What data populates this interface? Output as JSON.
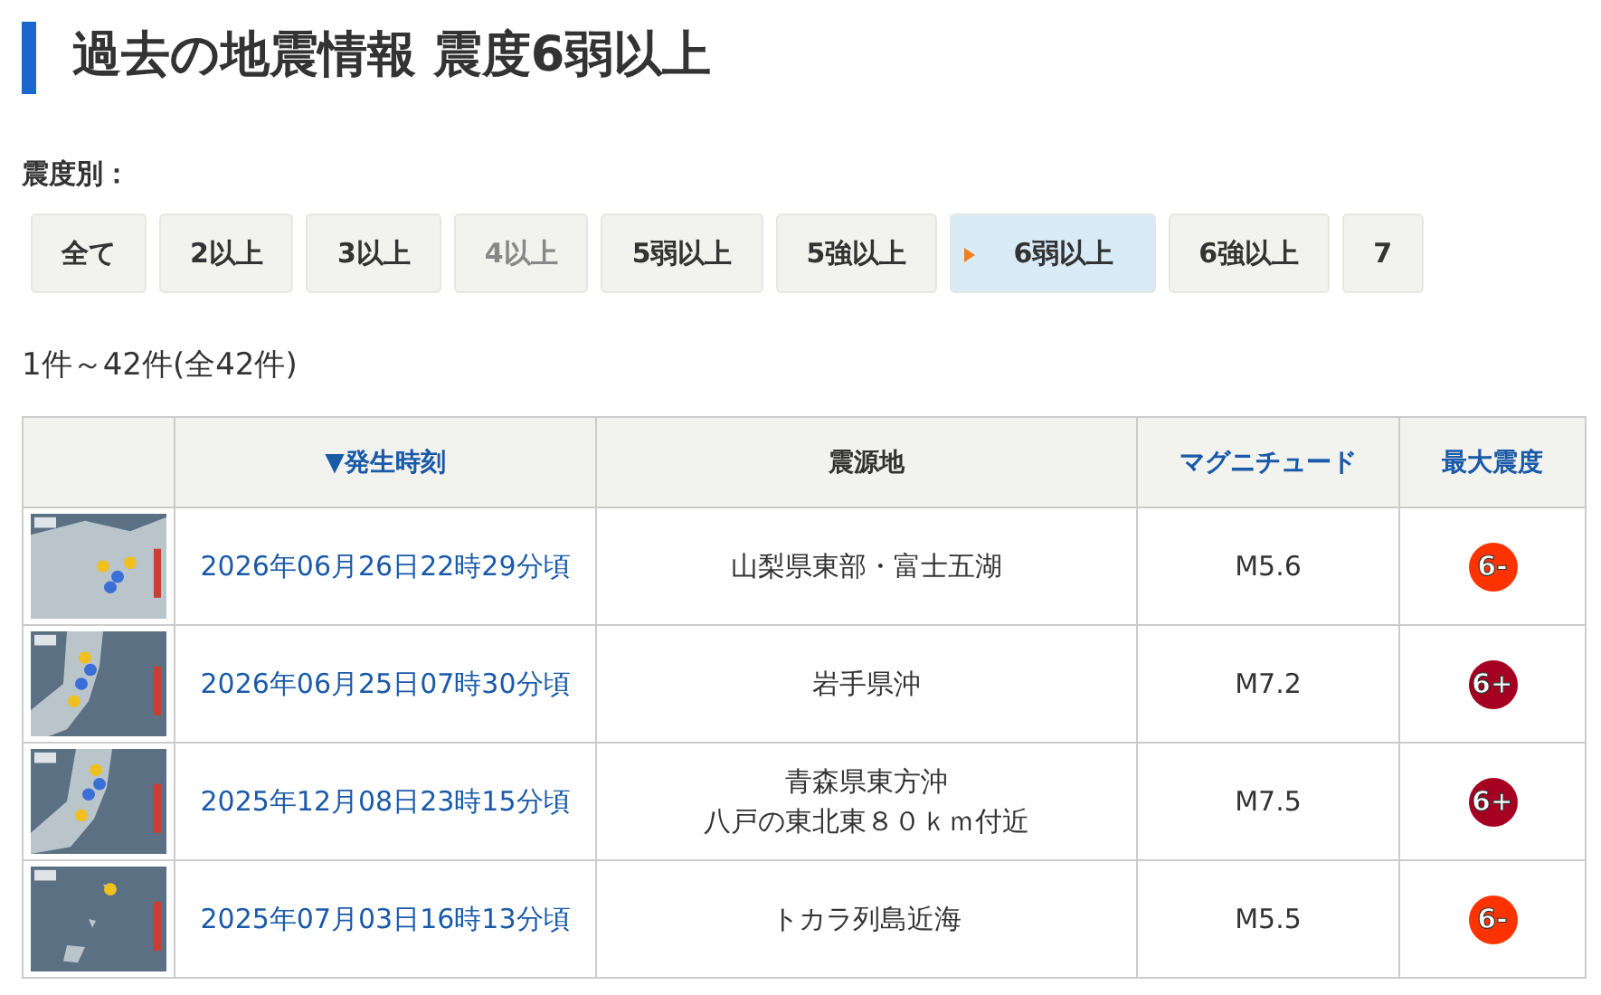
{
  "title": "過去の地震情報 震度6弱以上",
  "filter": {
    "label": "震度別：",
    "buttons": [
      {
        "label": "全て",
        "selected": false,
        "disabled": false
      },
      {
        "label": "2以上",
        "selected": false,
        "disabled": false
      },
      {
        "label": "3以上",
        "selected": false,
        "disabled": false
      },
      {
        "label": "4以上",
        "selected": false,
        "disabled": true
      },
      {
        "label": "5弱以上",
        "selected": false,
        "disabled": false
      },
      {
        "label": "5強以上",
        "selected": false,
        "disabled": false
      },
      {
        "label": "6弱以上",
        "selected": true,
        "disabled": false
      },
      {
        "label": "6強以上",
        "selected": false,
        "disabled": false
      },
      {
        "label": "7",
        "selected": false,
        "disabled": false
      }
    ]
  },
  "count": "1件～42件(全42件)",
  "table": {
    "columns": [
      {
        "label": "▼発生時刻",
        "link": true
      },
      {
        "label": "震源地",
        "link": false
      },
      {
        "label": "マグニチュード",
        "link": true
      },
      {
        "label": "最大震度",
        "link": true
      }
    ],
    "rows": [
      {
        "thumbnail": {
          "kind": "picture"
        },
        "time": "2026年06月26日22時29分頃",
        "epicenter": [
          "山梨県東部・富士五湖"
        ],
        "magnitude": "M5.6",
        "intensity": "6-",
        "color": "#ff3300"
      },
      {
        "thumbnail": {
          "kind": "picture"
        },
        "time": "2026年06月25日07時30分頃",
        "epicenter": [
          "岩手県沖"
        ],
        "magnitude": "M7.2",
        "intensity": "6+",
        "color": "#a50021"
      },
      {
        "thumbnail": {
          "kind": "picture"
        },
        "time": "2025年12月08日23時15分頃",
        "epicenter": [
          "青森県東方沖",
          "八戸の東北東８０ｋｍ付近"
        ],
        "magnitude": "M7.5",
        "intensity": "6+",
        "color": "#a50021"
      },
      {
        "thumbnail": {
          "kind": "picture"
        },
        "time": "2025年07月03日16時13分頃",
        "epicenter": [
          "トカラ列島近海"
        ],
        "magnitude": "M5.5",
        "intensity": "6-",
        "color": "#ff3300"
      }
    ]
  }
}
